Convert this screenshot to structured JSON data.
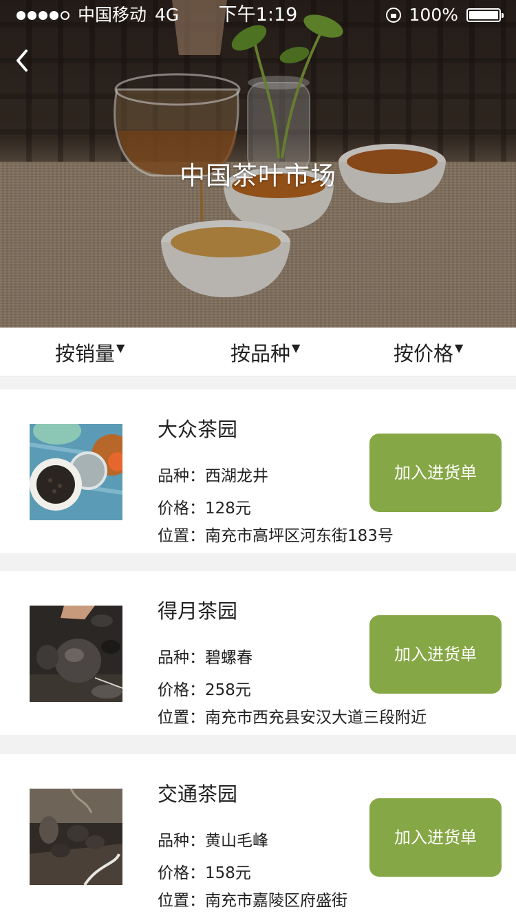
{
  "status_bar": {
    "carrier": "中国移动",
    "network": "4G",
    "time": "下午1:19",
    "battery": "100%"
  },
  "header": {
    "title": "中国茶叶市场",
    "back_icon": "chevron-left-icon"
  },
  "filters": [
    {
      "label": "按销量",
      "icon": "caret-down-icon"
    },
    {
      "label": "按品种",
      "icon": "caret-down-icon"
    },
    {
      "label": "按价格",
      "icon": "caret-down-icon"
    }
  ],
  "gardens": [
    {
      "name": "大众茶园",
      "variety_label": "品种：",
      "variety": "西湖龙井",
      "price_label": "价格：",
      "price": "128元",
      "location_label": "位置：",
      "location": "南充市高坪区河东街183号",
      "button_label": "加入进货单"
    },
    {
      "name": "得月茶园",
      "variety_label": "品种：",
      "variety": "碧螺春",
      "price_label": "价格：",
      "price": "258元",
      "location_label": "位置：",
      "location": "南充市西充县安汉大道三段附近",
      "button_label": "加入进货单"
    },
    {
      "name": "交通茶园",
      "variety_label": "品种：",
      "variety": "黄山毛峰",
      "price_label": "价格：",
      "price": "158元",
      "location_label": "位置：",
      "location": "南充市嘉陵区府盛街",
      "button_label": "加入进货单"
    }
  ],
  "colors": {
    "accent": "#86a745",
    "background": "#f2f2f2"
  }
}
